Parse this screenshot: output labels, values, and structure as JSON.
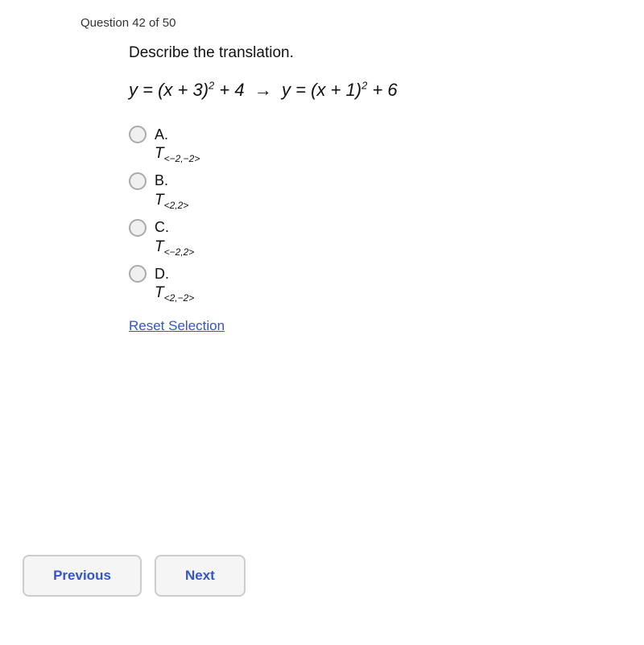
{
  "header": {
    "counter": "Question 42 of 50"
  },
  "question": {
    "prompt": "Describe the translation.",
    "equation": "y = (x + 3)² + 4 → y = (x + 1)² + 6"
  },
  "options": [
    {
      "id": "A",
      "label": "A.",
      "value": "T<−2,−2>"
    },
    {
      "id": "B",
      "label": "B.",
      "value": "T<2,2>"
    },
    {
      "id": "C",
      "label": "C.",
      "value": "T<−2,2>"
    },
    {
      "id": "D",
      "label": "D.",
      "value": "T<2,−2>"
    }
  ],
  "reset_label": "Reset Selection",
  "buttons": {
    "previous": "Previous",
    "next": "Next"
  }
}
